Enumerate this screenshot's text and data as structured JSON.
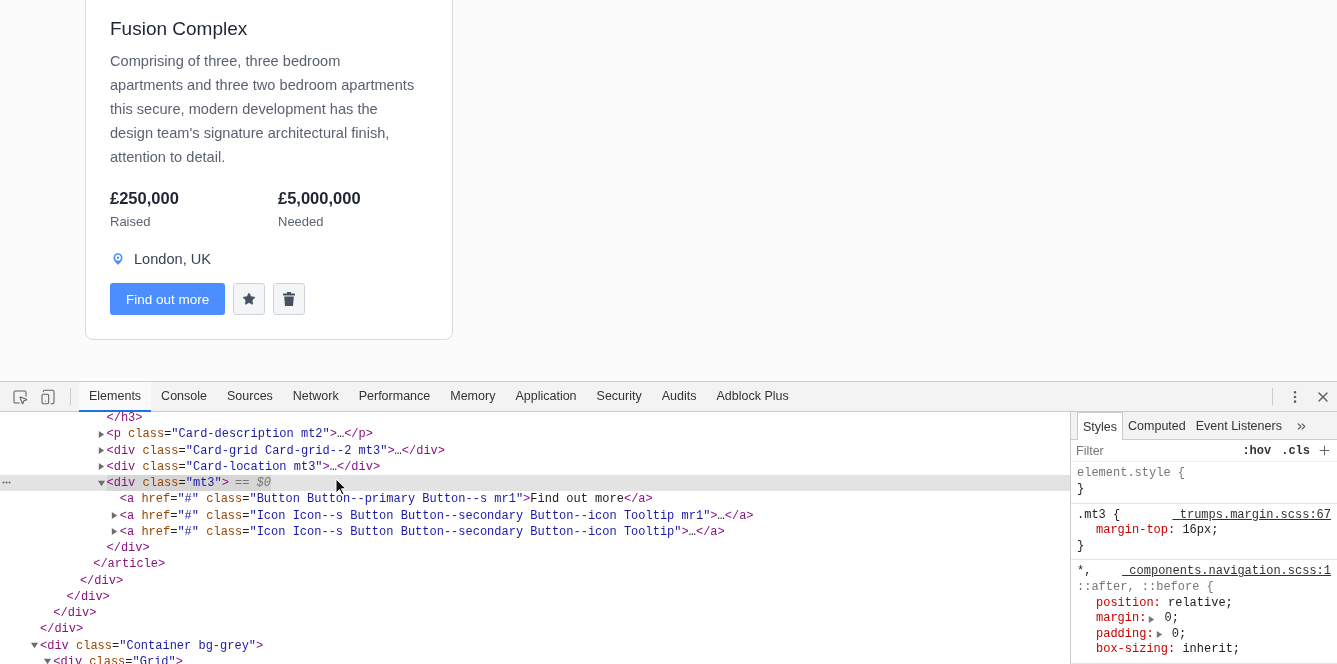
{
  "card": {
    "title": "Fusion Complex",
    "description": "Comprising of three, three bedroom apartments and three two bedroom apartments this secure, modern development has the design team's signature architectural finish, attention to detail.",
    "stats": [
      {
        "value": "£250,000",
        "label": "Raised"
      },
      {
        "value": "£5,000,000",
        "label": "Needed"
      }
    ],
    "location": "London, UK",
    "primary_button": "Find out more"
  },
  "devtools": {
    "tabs": [
      {
        "label": "Elements",
        "selected": true
      },
      {
        "label": "Console",
        "selected": false
      },
      {
        "label": "Sources",
        "selected": false
      },
      {
        "label": "Network",
        "selected": false
      },
      {
        "label": "Performance",
        "selected": false
      },
      {
        "label": "Memory",
        "selected": false
      },
      {
        "label": "Application",
        "selected": false
      },
      {
        "label": "Security",
        "selected": false
      },
      {
        "label": "Audits",
        "selected": false
      },
      {
        "label": "Adblock Plus",
        "selected": false
      }
    ],
    "dom_tree": [
      {
        "close": "</div>",
        "children": [
          {
            "close": "</div>",
            "children": [
              {
                "close": "</div>",
                "children": [
                  {
                    "close": "</div>",
                    "children": [
                      {
                        "close": "</article>",
                        "children": [
                          {
                            "close": "</h3>"
                          },
                          {
                            "open": "<p class=\"Card-description mt2\">",
                            "close": "</p>",
                            "hidden_content": "…",
                            "expanded": false,
                            "selected": false
                          },
                          {
                            "open": "<div class=\"Card-grid Card-grid--2 mt3\">",
                            "close": "</div>",
                            "hidden_content": "…",
                            "expanded": false,
                            "selected": false
                          },
                          {
                            "open": "<div class=\"Card-location mt3\">",
                            "close": "</div>",
                            "hidden_content": "…",
                            "expanded": false,
                            "selected": false
                          },
                          {
                            "open": "<div class=\"mt3\">",
                            "close": "</div>",
                            "note": "== $0",
                            "expanded": true,
                            "selected": true,
                            "children": [
                              {
                                "open": "<a href=\"#\" class=\"Button Button--primary Button--s mr1\">",
                                "text": "Find out more",
                                "close": "</a>",
                                "selected": false
                              },
                              {
                                "open": "<a href=\"#\" class=\"Icon Icon--s Button Button--secondary Button--icon Tooltip mr1\">",
                                "close": "</a>",
                                "hidden_content": "…",
                                "expanded": false,
                                "selected": false
                              },
                              {
                                "open": "<a href=\"#\" class=\"Icon Icon--s Button Button--secondary Button--icon Tooltip\">",
                                "close": "</a>",
                                "hidden_content": "…",
                                "expanded": false,
                                "selected": false
                              }
                            ]
                          }
                        ]
                      }
                    ]
                  }
                ]
              }
            ]
          }
        ]
      },
      {
        "open": "<div class=\"Container bg-grey\">",
        "expanded": true,
        "selected": false,
        "children": [
          {
            "open": "<div class=\"Grid\">",
            "expanded": true,
            "selected": false
          }
        ]
      }
    ],
    "sidebar_tabs": [
      {
        "label": "Styles",
        "selected": true
      },
      {
        "label": "Computed",
        "selected": false
      },
      {
        "label": "Event Listeners",
        "selected": false
      }
    ],
    "filter": {
      "placeholder": "Filter"
    },
    "filter_buttons": [
      ":hov",
      ".cls"
    ],
    "rules": [
      {
        "selectors": [
          {
            "text": "element.style {",
            "dimmed": true
          }
        ],
        "close": "}"
      },
      {
        "selectors": [
          {
            "text": ".mt3 {",
            "dimmed": false
          }
        ],
        "source": "_trumps.margin.scss:67",
        "properties": [
          {
            "text": "margin-top: 16px;"
          }
        ],
        "close": "}"
      },
      {
        "selectors": [
          {
            "text": "*,",
            "dimmed": false
          },
          {
            "text": "::after, ::before {",
            "dimmed": true
          }
        ],
        "source": "_components.navigation.scss:1",
        "properties": [
          {
            "text": "position: relative;"
          },
          {
            "text": "margin: 0;",
            "expandable": true
          },
          {
            "text": "padding: 0;",
            "expandable": true
          },
          {
            "text": "box-sizing: inherit;"
          }
        ]
      }
    ]
  }
}
